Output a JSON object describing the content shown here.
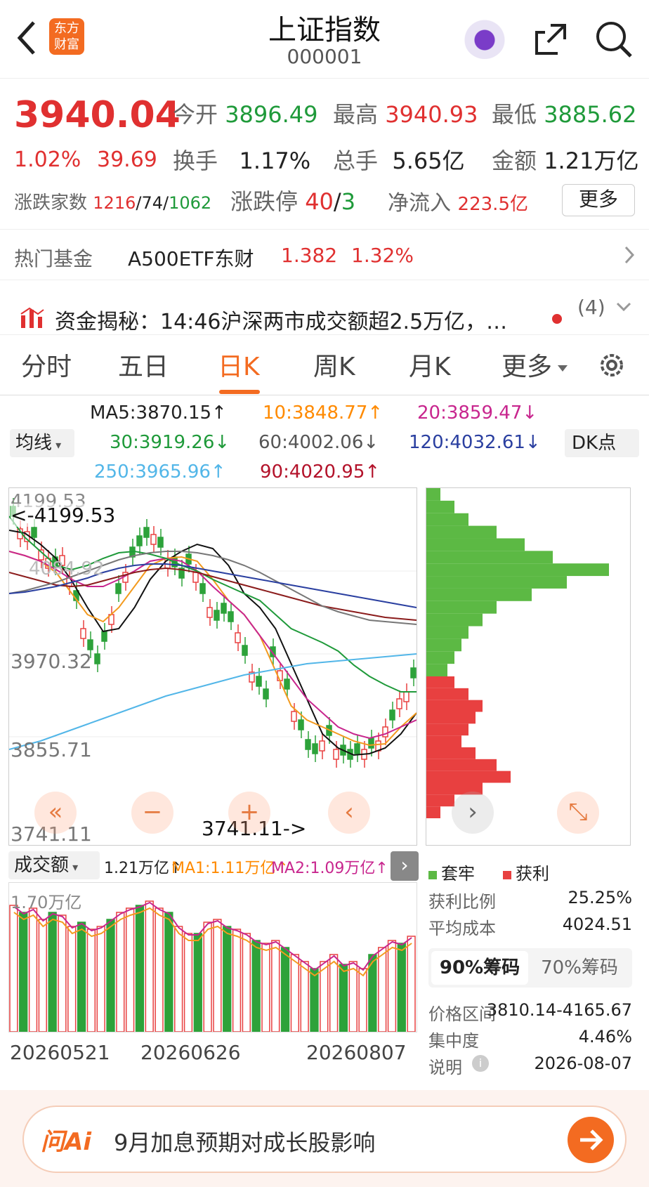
{
  "header": {
    "title": "上证指数",
    "code": "000001",
    "logo_line1": "东方",
    "logo_line2": "财富"
  },
  "quote": {
    "price": "3940.04",
    "change_pct": "1.02%",
    "change": "39.69",
    "open_label": "今开",
    "open": "3896.49",
    "high_label": "最高",
    "high": "3940.93",
    "low_label": "最低",
    "low": "3885.62",
    "turnover_label": "换手",
    "turnover": "1.17%",
    "volume_label": "总手",
    "volume": "5.65亿",
    "amount_label": "金额",
    "amount": "1.21万亿",
    "breadth_label": "涨跌家数",
    "breadth_up": "1216",
    "breadth_flat": "74",
    "breadth_down": "1062",
    "sep": "/",
    "limit_label": "涨跌停",
    "limit_up": "40",
    "limit_down": "3",
    "netflow_label": "净流入",
    "netflow": "223.5亿",
    "more": "更多"
  },
  "fund": {
    "label": "热门基金",
    "name": "A500ETF东财",
    "price": "1.382",
    "pct": "1.32%"
  },
  "news": {
    "text": "资金揭秘：14:46沪深两市成交额超2.5万亿，…",
    "count": "(4)"
  },
  "tabs": [
    "分时",
    "五日",
    "日K",
    "周K",
    "月K",
    "更多"
  ],
  "ma": {
    "selector": "均线",
    "ma5": "MA5:3870.15↑",
    "ma10": "10:3848.77↑",
    "ma20": "20:3859.47↓",
    "ma30": "30:3919.26↓",
    "ma60": "60:4002.06↓",
    "ma120": "120:4032.61↓",
    "ma250": "250:3965.96↑",
    "ma90": "90:4020.95↑",
    "dk": "DK点"
  },
  "price_axis": {
    "top": "4199.53",
    "mid1": "3970.32",
    "mid2": "3855.71",
    "bottom": "3741.11",
    "mark_high": "<-4199.53",
    "mark_low": "3741.11->",
    "faint": "4084.92"
  },
  "volume": {
    "selector": "成交额",
    "value": "1.21万亿↑",
    "ma1": "MA1:1.11万亿↑",
    "ma2": "MA2:1.09万亿↑",
    "axis": "1.70万亿"
  },
  "dates": [
    "20260521",
    "20260626",
    "20260807"
  ],
  "chips": {
    "trapped": "套牢",
    "profit": "获利",
    "profit_ratio_label": "获利比例",
    "profit_ratio": "25.25%",
    "avg_cost_label": "平均成本",
    "avg_cost": "4024.51",
    "tab90": "90%筹码",
    "tab70": "70%筹码",
    "range_label": "价格区间",
    "range": "3810.14-4165.67",
    "conc_label": "集中度",
    "conc": "4.46%",
    "note_label": "说明",
    "note_date": "2026-08-07"
  },
  "ai": {
    "brand": "问Ai",
    "prompt": "9月加息预期对成长股影响"
  },
  "colors": {
    "red": "#e03030",
    "green": "#1f9a3a",
    "accent": "#ff6a00"
  }
}
